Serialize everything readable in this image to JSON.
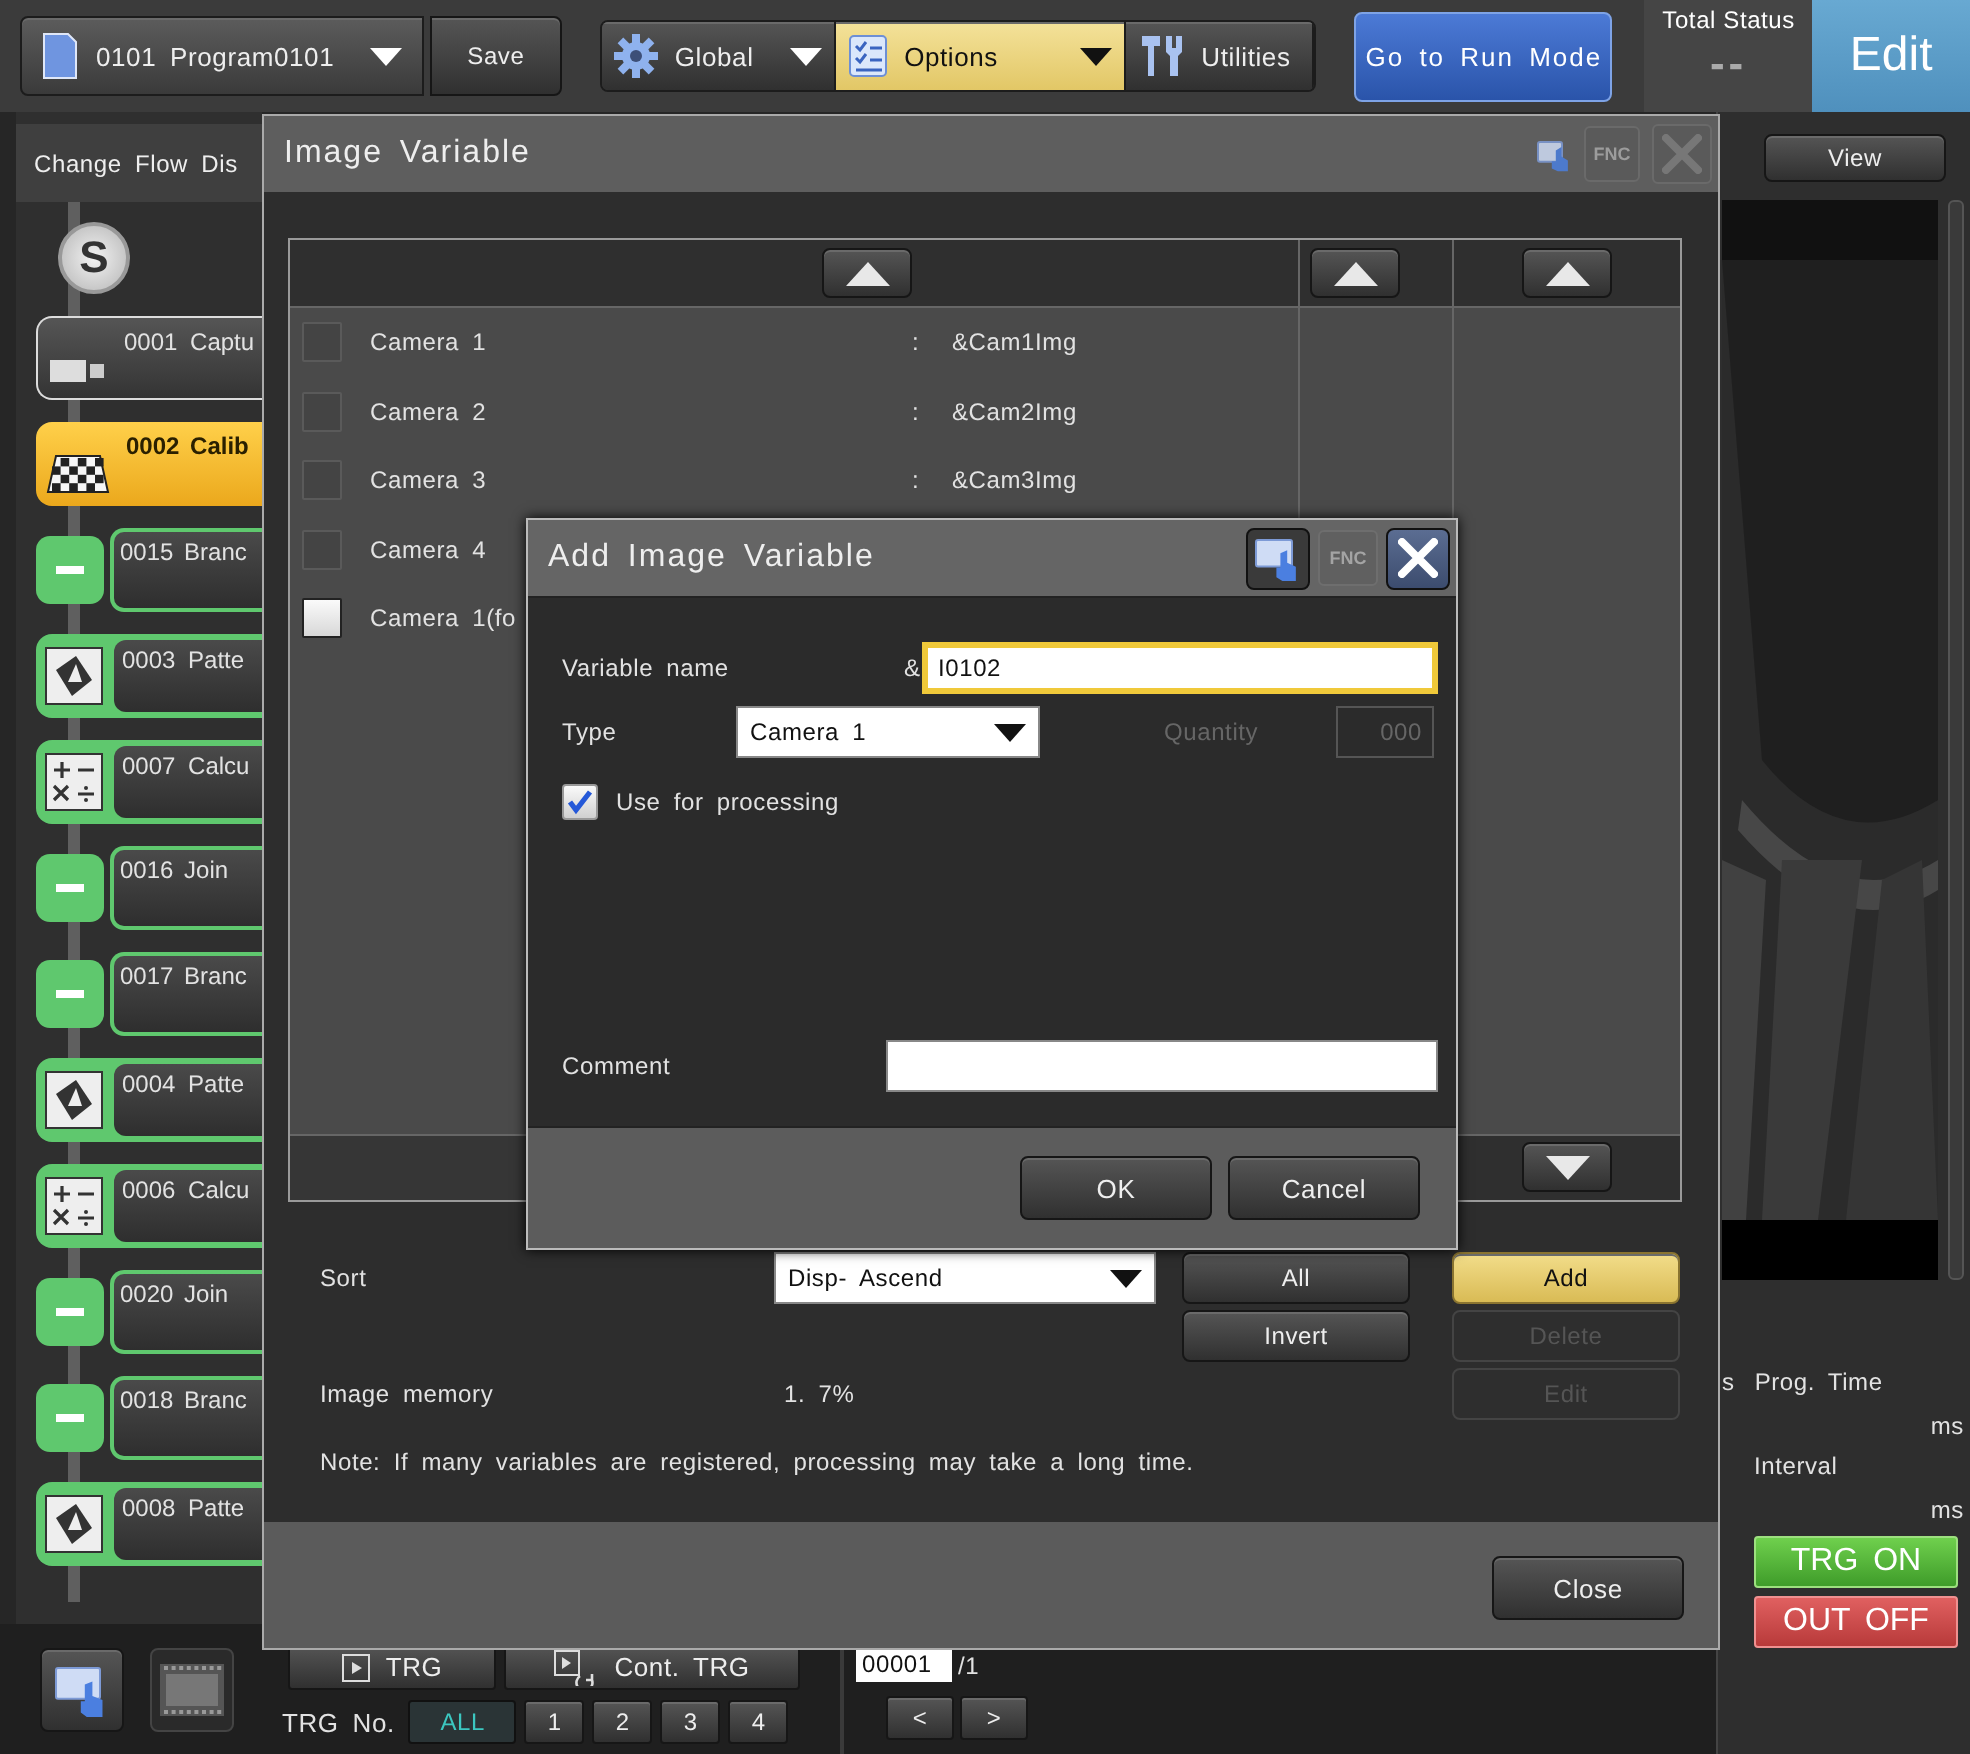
{
  "toolbar": {
    "program": "0101 Program0101",
    "save": "Save",
    "menus": [
      {
        "label": "Global",
        "kind": "global",
        "selected": false
      },
      {
        "label": "Options",
        "kind": "options",
        "selected": true
      },
      {
        "label": "Utilities",
        "kind": "utilities",
        "selected": false
      }
    ],
    "run_mode": "Go to Run Mode",
    "total_status": {
      "label": "Total Status",
      "value": "--"
    },
    "mode": "Edit"
  },
  "flow_panel": {
    "title": "Change Flow Dis",
    "start": "S",
    "items": [
      {
        "label": "0001 Captu",
        "kind": "capture",
        "selected": false
      },
      {
        "label": "0002 Calib",
        "kind": "calibration",
        "selected": true
      },
      {
        "label": "0015 Branc",
        "kind": "branch",
        "selected": false
      },
      {
        "label": "0003 Patte",
        "kind": "pattern",
        "selected": false
      },
      {
        "label": "0007 Calcu",
        "kind": "calculation",
        "selected": false
      },
      {
        "label": "0016 Join",
        "kind": "join",
        "selected": false
      },
      {
        "label": "0017 Branc",
        "kind": "branch",
        "selected": false
      },
      {
        "label": "0004 Patte",
        "kind": "pattern",
        "selected": false
      },
      {
        "label": "0006 Calcu",
        "kind": "calculation",
        "selected": false
      },
      {
        "label": "0020 Join",
        "kind": "join",
        "selected": false
      },
      {
        "label": "0018 Branc",
        "kind": "branch",
        "selected": false
      },
      {
        "label": "0008 Patte",
        "kind": "pattern",
        "selected": false
      }
    ]
  },
  "view_panel": {
    "view_button": "View",
    "cut_label": "s",
    "stats": [
      {
        "label": "Prog. Time",
        "unit": "ms"
      },
      {
        "label": "Interval",
        "unit": "ms"
      }
    ],
    "outputs": [
      {
        "label": "TRG ON",
        "on": true
      },
      {
        "label": "OUT OFF",
        "on": false
      }
    ]
  },
  "trigger_bar": {
    "trg": "TRG",
    "cont_trg": "Cont. TRG",
    "trg_no_label": "TRG No.",
    "trg_numbers": [
      {
        "label": "ALL",
        "selected": true
      },
      {
        "label": "1",
        "selected": false
      },
      {
        "label": "2",
        "selected": false
      },
      {
        "label": "3",
        "selected": false
      },
      {
        "label": "4",
        "selected": false
      }
    ]
  },
  "counter": {
    "value": "00001",
    "total": "/1",
    "prev": "<",
    "next": ">"
  },
  "image_variable_dialog": {
    "title": "Image Variable",
    "fnc": "FNC",
    "rows": [
      {
        "name": "Camera 1",
        "separator": ":",
        "variable": "&Cam1Img",
        "checked": false,
        "disabled": true
      },
      {
        "name": "Camera 2",
        "separator": ":",
        "variable": "&Cam2Img",
        "checked": false,
        "disabled": true
      },
      {
        "name": "Camera 3",
        "separator": ":",
        "variable": "&Cam3Img",
        "checked": false,
        "disabled": true
      },
      {
        "name": "Camera 4",
        "checked": false,
        "disabled": true
      },
      {
        "name": "Camera 1(fo",
        "checked": false,
        "disabled": false
      }
    ],
    "sort": {
      "label": "Sort",
      "value": "Disp- Ascend"
    },
    "select_buttons": [
      "All",
      "Invert"
    ],
    "action_buttons": [
      {
        "label": "Add",
        "highlighted": true,
        "disabled": false
      },
      {
        "label": "Delete",
        "highlighted": false,
        "disabled": true
      },
      {
        "label": "Edit",
        "highlighted": false,
        "disabled": true
      }
    ],
    "memory": {
      "label": "Image memory",
      "value": "1. 7%"
    },
    "note": "Note: If many variables are registered, processing may take a long time.",
    "close": "Close"
  },
  "add_image_variable_dialog": {
    "title": "Add Image Variable",
    "fnc": "FNC",
    "variable_name": {
      "label": "Variable name",
      "prefix": "&",
      "value": "I0102"
    },
    "type": {
      "label": "Type",
      "value": "Camera 1"
    },
    "quantity": {
      "label": "Quantity",
      "value": "000",
      "disabled": true
    },
    "use_for_processing": {
      "label": "Use for processing",
      "checked": true
    },
    "comment": {
      "label": "Comment"
    },
    "buttons": [
      "OK",
      "Cancel"
    ]
  }
}
